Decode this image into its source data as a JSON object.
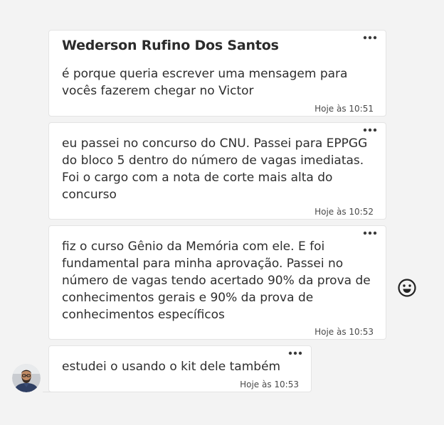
{
  "messages": [
    {
      "sender": "Wederson Rufino Dos Santos",
      "text": "é porque queria escrever uma mensagem para vocês fazerem chegar no Victor",
      "time": "Hoje às 10:51"
    },
    {
      "text": "eu passei no concurso do CNU. Passei para EPPGG do bloco 5 dentro do número de vagas imediatas. Foi o cargo com a nota de corte mais alta do concurso",
      "time": "Hoje às 10:52"
    },
    {
      "text": "fiz o curso Gênio da Memória com ele. E foi fundamental para minha aprovação. Passei no número de vagas tendo acertado 90% da prova de conhecimentos gerais e 90% da prova de conhecimentos específicos",
      "time": "Hoje às 10:53"
    },
    {
      "text": "estudei o usando o kit dele também",
      "time": "Hoje às 10:53"
    }
  ],
  "icons": {
    "more": "more-options-icon",
    "emoji": "smiley-emoji-icon",
    "avatar": "user-avatar"
  },
  "colors": {
    "background": "#f3f3f3",
    "bubble": "#ffffff",
    "text": "#2e2e2e"
  }
}
